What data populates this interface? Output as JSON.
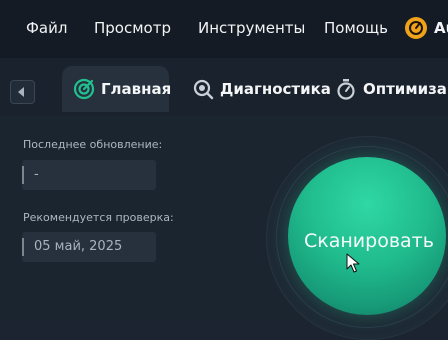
{
  "menu": {
    "items": [
      "Файл",
      "Просмотр",
      "Инструменты",
      "Помощь"
    ],
    "app_name": "Au"
  },
  "tabs": [
    {
      "label": "Главная",
      "icon": "target-icon",
      "active": true
    },
    {
      "label": "Диагностика",
      "icon": "magnifier-icon",
      "active": false
    },
    {
      "label": "Оптимизаци",
      "icon": "stopwatch-icon",
      "active": false
    }
  ],
  "main": {
    "last_update_label": "Последнее обновление:",
    "last_update_value": "-",
    "recommended_label": "Рекомендуется проверка:",
    "recommended_value": "05 май, 2025",
    "scan_button_label": "Сканировать"
  },
  "colors": {
    "accent": "#20bb8d",
    "background": "#1b2430",
    "menubar": "#141b24",
    "logo": "#f0a21b"
  }
}
